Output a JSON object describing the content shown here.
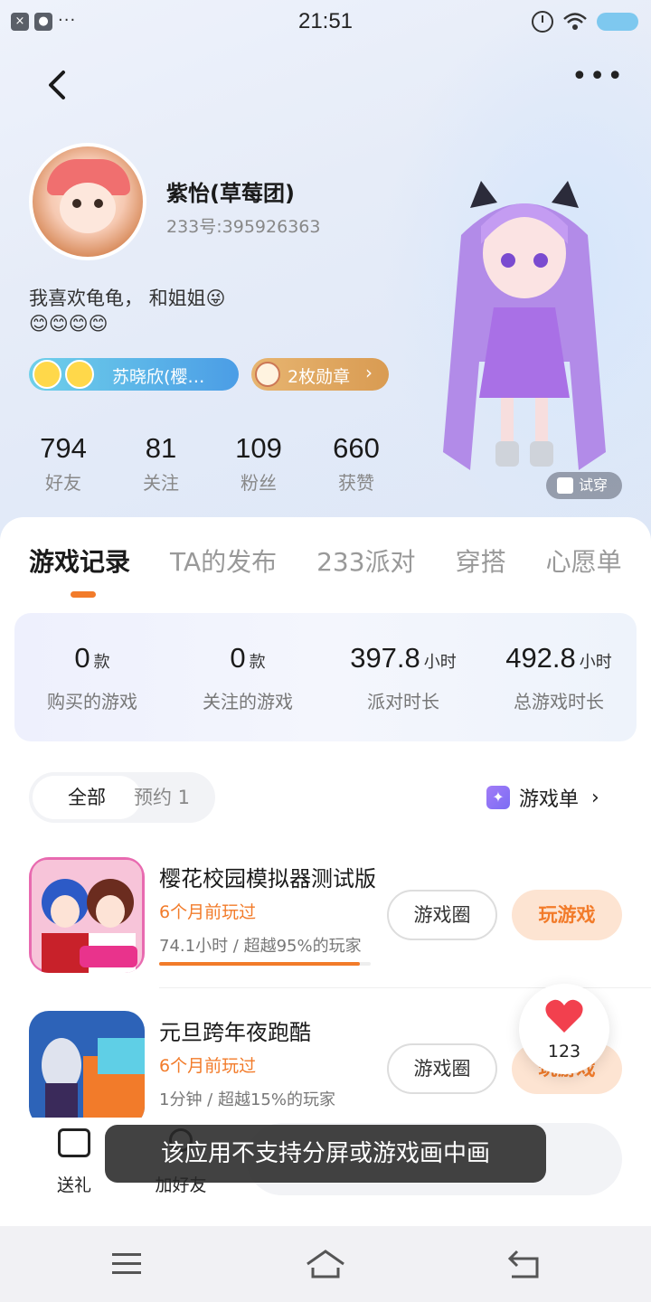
{
  "status_bar": {
    "time": "21:51"
  },
  "profile": {
    "nickname": "紫怡(草莓团)",
    "uid": "233号:395926363",
    "bio_line1": "我喜欢龟龟， 和姐姐😜",
    "bio_line2": "😊😊😊😊",
    "group_label": "苏晓欣(樱…",
    "badge_label": "2枚勋章",
    "stats": [
      {
        "value": "794",
        "label": "好友"
      },
      {
        "value": "81",
        "label": "关注"
      },
      {
        "value": "109",
        "label": "粉丝"
      },
      {
        "value": "660",
        "label": "获赞"
      }
    ],
    "try_on_label": "试穿"
  },
  "tabs": [
    {
      "label": "游戏记录",
      "active": true
    },
    {
      "label": "TA的发布"
    },
    {
      "label": "233派对"
    },
    {
      "label": "穿搭"
    },
    {
      "label": "心愿单"
    }
  ],
  "summary": [
    {
      "value": "0",
      "unit": "款",
      "label": "购买的游戏"
    },
    {
      "value": "0",
      "unit": "款",
      "label": "关注的游戏"
    },
    {
      "value": "397.8",
      "unit": "小时",
      "label": "派对时长"
    },
    {
      "value": "492.8",
      "unit": "小时",
      "label": "总游戏时长"
    }
  ],
  "filter": {
    "all_label": "全部",
    "reserve_label": "预约 1",
    "game_list_label": "游戏单"
  },
  "games": [
    {
      "title": "樱花校园模拟器测试版",
      "last_played": "6个月前玩过",
      "progress_text": "74.1小时 / 超越95%的玩家",
      "beat_percent": 95,
      "circle_label": "游戏圈",
      "play_label": "玩游戏"
    },
    {
      "title": "元旦跨年夜跑酷",
      "last_played": "6个月前玩过",
      "progress_text": "1分钟 / 超越15%的玩家",
      "beat_percent": 15,
      "circle_label": "游戏圈",
      "play_label": "玩游戏"
    }
  ],
  "like_count": "123",
  "bottom": {
    "gift_label": "送礼",
    "add_friend_label": "加好友"
  },
  "toast": "该应用不支持分屏或游戏画中画",
  "colors": {
    "accent": "#f27b2a",
    "play_bg": "#fde4d2"
  }
}
